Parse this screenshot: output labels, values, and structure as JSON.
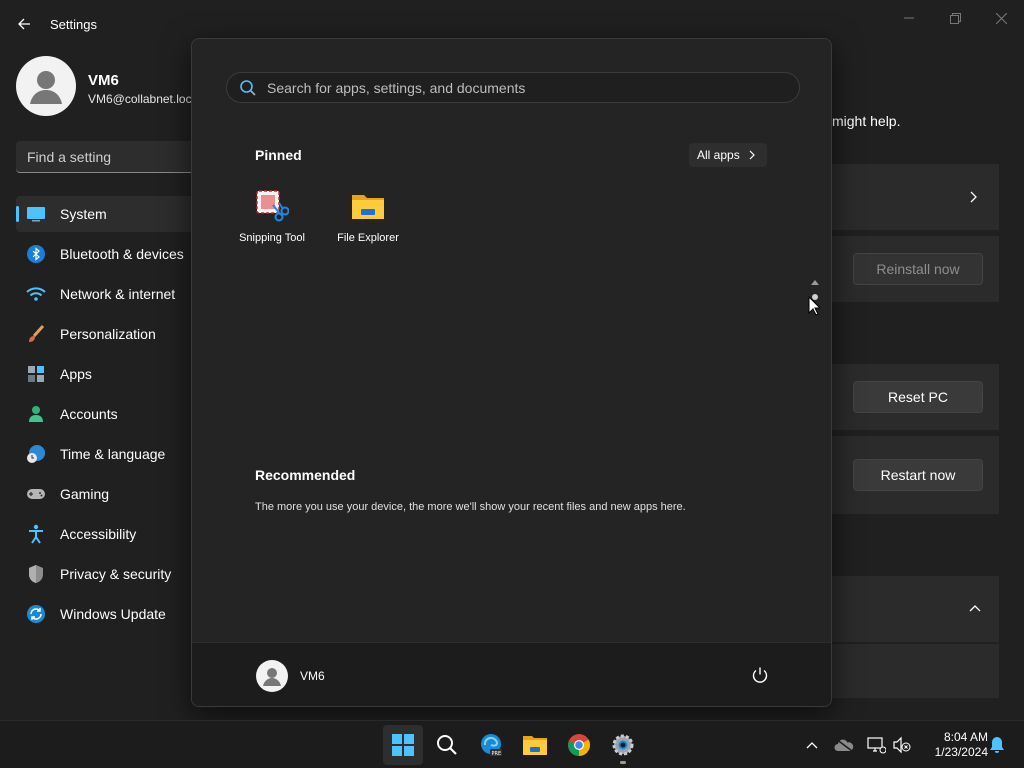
{
  "window": {
    "title": "Settings"
  },
  "user": {
    "name": "VM6",
    "email": "VM6@collabnet.loc"
  },
  "search_setting": {
    "placeholder": "Find a setting"
  },
  "nav": {
    "items": [
      {
        "label": "System",
        "icon": "system-icon",
        "active": true
      },
      {
        "label": "Bluetooth & devices",
        "icon": "bluetooth-icon"
      },
      {
        "label": "Network & internet",
        "icon": "wifi-icon"
      },
      {
        "label": "Personalization",
        "icon": "brush-icon"
      },
      {
        "label": "Apps",
        "icon": "apps-icon"
      },
      {
        "label": "Accounts",
        "icon": "person-icon"
      },
      {
        "label": "Time & language",
        "icon": "globe-clock-icon"
      },
      {
        "label": "Gaming",
        "icon": "gamepad-icon"
      },
      {
        "label": "Accessibility",
        "icon": "accessibility-icon"
      },
      {
        "label": "Privacy & security",
        "icon": "shield-icon"
      },
      {
        "label": "Windows Update",
        "icon": "update-icon"
      }
    ]
  },
  "settings_main": {
    "partial_text": "might help.",
    "reinstall_label": "Reinstall now",
    "reset_label": "Reset PC",
    "restart_label": "Restart now"
  },
  "start_menu": {
    "search_placeholder": "Search for apps, settings, and documents",
    "pinned_title": "Pinned",
    "all_apps_label": "All apps",
    "pinned_apps": [
      {
        "label": "Snipping Tool",
        "icon": "snipping-tool-icon"
      },
      {
        "label": "File Explorer",
        "icon": "file-explorer-icon"
      }
    ],
    "recommended_title": "Recommended",
    "recommended_text": "The more you use your device, the more we'll show your recent files and new apps here.",
    "footer_user": "VM6"
  },
  "taskbar": {
    "time": "8:04 AM",
    "date": "1/23/2024",
    "apps": [
      "start-icon",
      "search-icon",
      "edge-dev-icon",
      "file-explorer-icon",
      "chrome-icon",
      "settings-icon"
    ]
  },
  "colors": {
    "accent": "#4cc2ff",
    "background": "#202020",
    "start_bg": "#242424"
  }
}
